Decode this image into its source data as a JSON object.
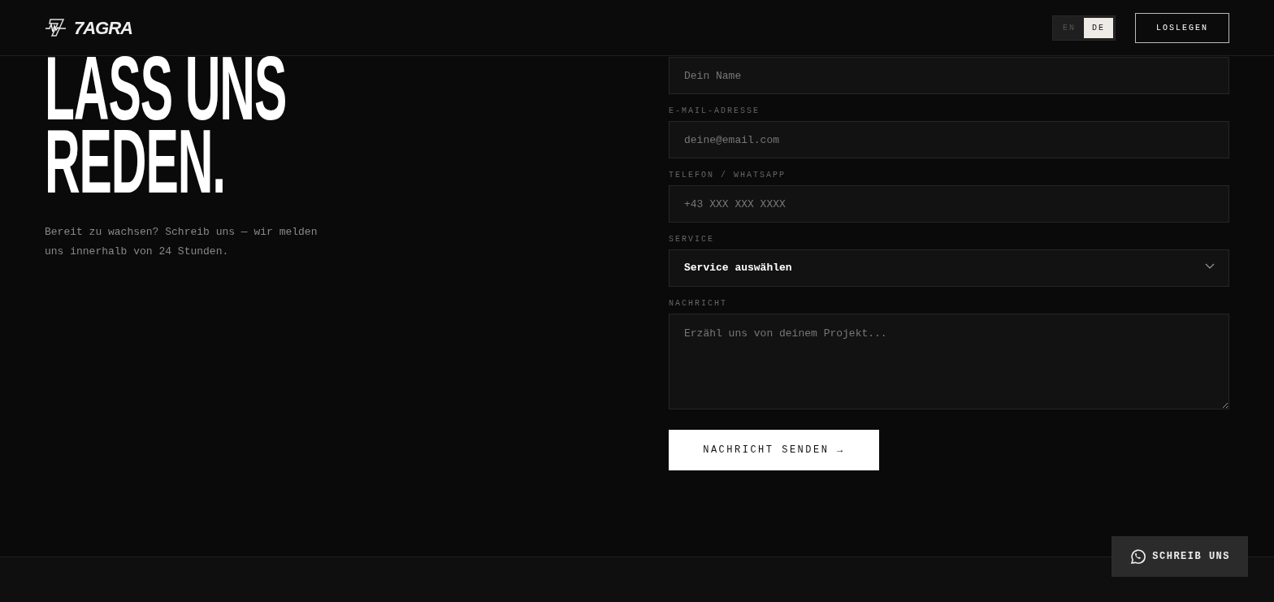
{
  "header": {
    "logo_text": "7AGRA",
    "languages": [
      {
        "label": "EN",
        "selected": false
      },
      {
        "label": "DE",
        "selected": true
      }
    ],
    "cta": "LOSLEGEN"
  },
  "hero": {
    "heading_lines": [
      "LASS UNS",
      "REDEN."
    ],
    "intro": "Bereit zu wachsen? Schreib uns — wir melden uns innerhalb von 24 Stunden."
  },
  "form": {
    "fields": [
      {
        "kind": "input",
        "placeholder": "Dein Name"
      },
      {
        "kind": "input",
        "label": "E-MAIL-ADRESSE",
        "placeholder": "deine@email.com"
      },
      {
        "kind": "input",
        "label": "TELEFON / WHATSAPP",
        "placeholder": "+43 XXX XXX XXXX"
      },
      {
        "kind": "select",
        "label": "SERVICE",
        "value": "Service auswählen"
      },
      {
        "kind": "textarea",
        "label": "NACHRICHT",
        "placeholder": "Erzähl uns von deinem Projekt..."
      }
    ],
    "submit": "NACHRICHT SENDEN →"
  },
  "floating_button": {
    "label": "SCHREIB UNS"
  }
}
